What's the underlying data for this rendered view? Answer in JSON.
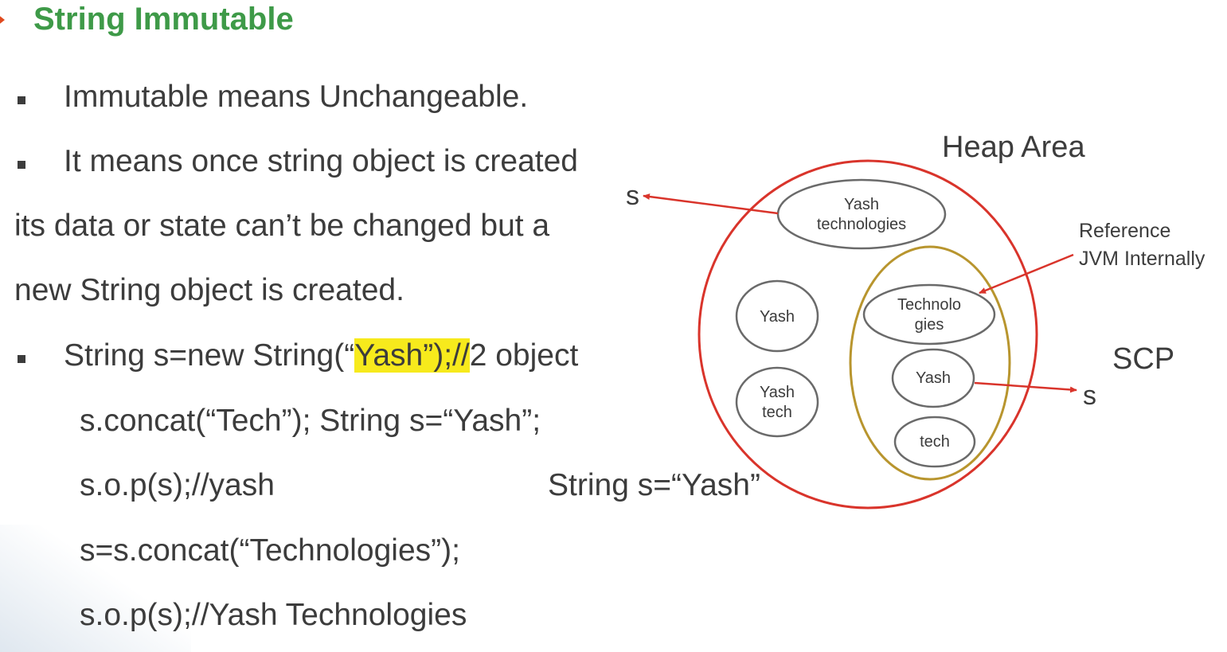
{
  "slide": {
    "title": "String Immutable"
  },
  "content": {
    "bullet1": "Immutable means Unchangeable.",
    "bullet2_line1": "It means once string object is created",
    "bullet2_line2": "its data or state can’t be changed but a",
    "bullet2_line3": "new String object is created.",
    "code1_pre": "String s=new String(“",
    "code1_highlight": "Yash”);//",
    "code1_post": "2 object",
    "code2": "s.concat(“Tech”); String s=“Yash”;",
    "code3": "s.o.p(s);//yash",
    "code3_right": "String s=“Yash”",
    "code4": "s=s.concat(“Technologies”);",
    "code5": "s.o.p(s);//Yash Technologies"
  },
  "diagram": {
    "heap_label": "Heap Area",
    "scp_label": "SCP",
    "reference_line1": "Reference",
    "reference_line2": "JVM Internally",
    "s_left": "s",
    "s_right": "s",
    "node_yash_tech_line1": "Yash",
    "node_yash_tech_line2": "technologies",
    "node_heap_yash": "Yash",
    "node_heap_yashtech_line1": "Yash",
    "node_heap_yashtech_line2": "tech",
    "node_scp_tech_line1": "Technolo",
    "node_scp_tech_line2": "gies",
    "node_scp_yash": "Yash",
    "node_scp_tech": "tech"
  },
  "colors": {
    "title": "#3e9a48",
    "heap_circle": "#d9342b",
    "scp_circle": "#b8952e",
    "arrow": "#d9342b",
    "highlight": "#f7ea1c"
  }
}
